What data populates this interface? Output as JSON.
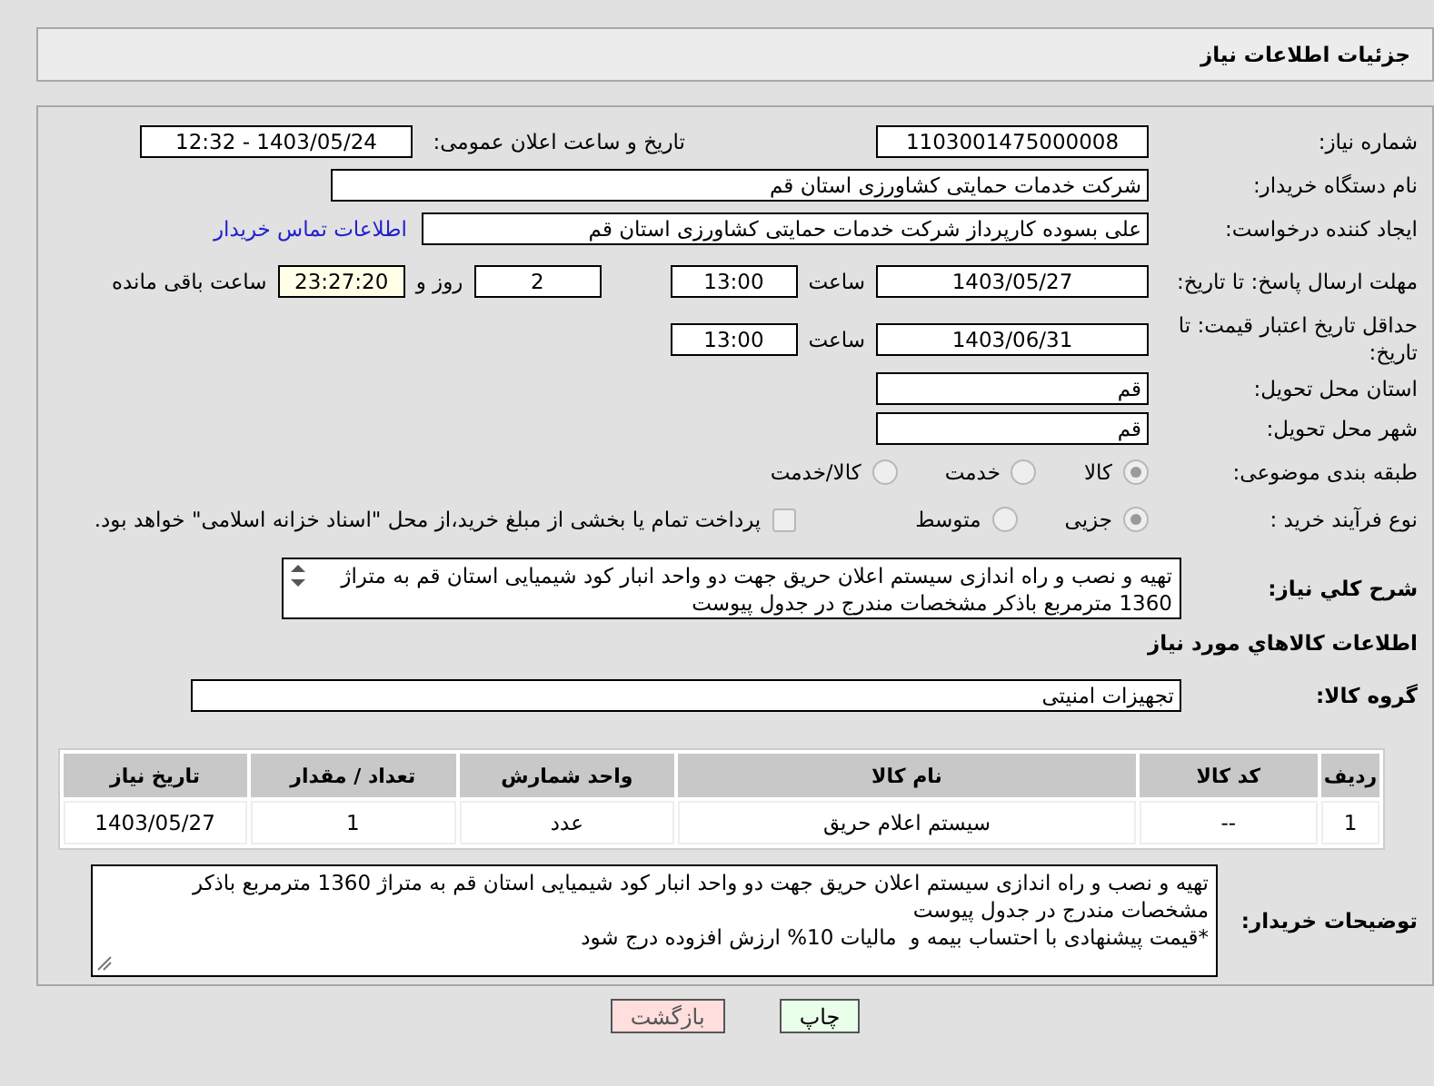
{
  "header": {
    "title": "جزئیات اطلاعات نیاز"
  },
  "need_number": {
    "label": "شماره نیاز:",
    "value": "1103001475000008"
  },
  "announce": {
    "label": "تاریخ و ساعت اعلان عمومی:",
    "value": "1403/05/24 - 12:32"
  },
  "buyer_org": {
    "label": "نام دستگاه خریدار:",
    "value": "شرکت خدمات حمایتی کشاورزی استان قم"
  },
  "requester": {
    "label": "ایجاد کننده درخواست:",
    "value": "علی بسوده کارپرداز شرکت خدمات حمایتی کشاورزی استان قم",
    "link": "اطلاعات تماس خریدار"
  },
  "deadline": {
    "label": "مهلت ارسال پاسخ: تا تاریخ:",
    "date": "1403/05/27",
    "time_label": "ساعت",
    "time": "13:00",
    "days": "2",
    "days_label": "روز و",
    "remaining": "23:27:20",
    "remaining_label": "ساعت باقی مانده"
  },
  "validity": {
    "label": "حداقل تاریخ اعتبار قیمت: تا تاریخ:",
    "date": "1403/06/31",
    "time_label": "ساعت",
    "time": "13:00"
  },
  "province": {
    "label": "استان محل تحویل:",
    "value": "قم"
  },
  "city": {
    "label": "شهر محل تحویل:",
    "value": "قم"
  },
  "category": {
    "label": "طبقه بندی موضوعی:",
    "options": [
      {
        "label": "کالا",
        "selected": true
      },
      {
        "label": "خدمت",
        "selected": false
      },
      {
        "label": "کالا/خدمت",
        "selected": false
      }
    ]
  },
  "process": {
    "label": "نوع فرآیند خرید :",
    "options": [
      {
        "label": "جزیی",
        "selected": true
      },
      {
        "label": "متوسط",
        "selected": false
      }
    ],
    "payment": {
      "label": "پرداخت تمام یا بخشی از مبلغ خرید،از محل \"اسناد خزانه اسلامی\" خواهد بود.",
      "checked": false
    }
  },
  "description": {
    "label": "شرح کلي نياز:",
    "value": "تهیه و نصب و راه اندازی سیستم اعلان حریق جهت دو واحد انبار کود شیمیایی استان قم به متراژ 1360 مترمربع باذکر مشخصات مندرج در جدول پیوست"
  },
  "goods_title": "اطلاعات کالاهاي مورد نياز",
  "goods_group": {
    "label": "گروه کالا:",
    "value": "تجهیزات امنیتی"
  },
  "table": {
    "columns": [
      "ردیف",
      "کد کالا",
      "نام کالا",
      "واحد شمارش",
      "تعداد / مقدار",
      "تاریخ نیاز"
    ],
    "rows": [
      [
        "1",
        "--",
        "سیستم اعلام حریق",
        "عدد",
        "1",
        "1403/05/27"
      ]
    ]
  },
  "buyer_notes": {
    "label": "توضیحات خریدار:",
    "value": "تهیه و نصب و راه اندازی سیستم اعلان حریق جهت دو واحد انبار کود شیمیایی استان قم به متراژ 1360 مترمربع باذکر مشخصات مندرج در جدول پیوست\n*قیمت پیشنهادی با احتساب بیمه و  مالیات 10% ارزش افزوده درج شود"
  },
  "buttons": [
    {
      "label": "چاپ",
      "kind": "print"
    },
    {
      "label": "بازگشت",
      "kind": "back"
    }
  ]
}
